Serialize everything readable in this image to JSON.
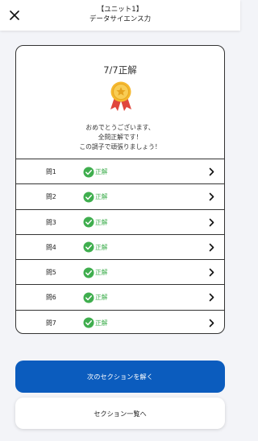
{
  "header": {
    "title": "【ユニット1】",
    "subtitle": "データサイエンス力",
    "close_icon": "close-icon"
  },
  "result": {
    "score": "7/7正解",
    "medal_icon": "medal-icon",
    "message_lines": [
      "おめでとうございます、",
      "全問正解です！",
      "この調子で頑張りましょう！"
    ]
  },
  "questions": [
    {
      "label": "問1",
      "status": "正解"
    },
    {
      "label": "問2",
      "status": "正解"
    },
    {
      "label": "問3",
      "status": "正解"
    },
    {
      "label": "問4",
      "status": "正解"
    },
    {
      "label": "問5",
      "status": "正解"
    },
    {
      "label": "問6",
      "status": "正解"
    },
    {
      "label": "問7",
      "status": "正解"
    }
  ],
  "buttons": {
    "next_section": "次のセクションを解く",
    "section_list": "セクション一覧へ"
  },
  "colors": {
    "primary": "#0b5cbe",
    "correct": "#3fae4e",
    "medal_gold": "#f5b82e",
    "ribbon_red": "#e0463c"
  }
}
